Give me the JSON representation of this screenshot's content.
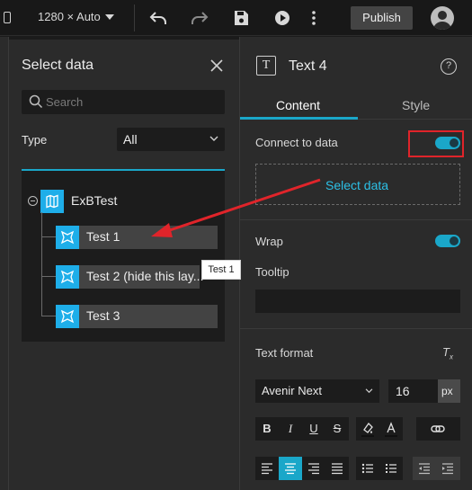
{
  "topbar": {
    "resolution_label": "1280 × Auto",
    "publish_label": "Publish"
  },
  "select_data": {
    "title": "Select data",
    "search_placeholder": "Search",
    "type_label": "Type",
    "type_value": "All",
    "tree": {
      "root": "ExBTest",
      "items": [
        {
          "label": "Test 1"
        },
        {
          "label": "Test 2 (hide this lay..."
        },
        {
          "label": "Test 3"
        }
      ]
    },
    "hover_tooltip": "Test 1"
  },
  "settings": {
    "title": "Text 4",
    "tabs": [
      {
        "label": "Content"
      },
      {
        "label": "Style"
      }
    ],
    "connect_to_data_label": "Connect to data",
    "connect_to_data_on": true,
    "select_data_button": "Select data",
    "wrap_label": "Wrap",
    "wrap_on": true,
    "tooltip_label": "Tooltip",
    "text_format_label": "Text format",
    "font_family": "Avenir Next",
    "font_size": "16",
    "font_unit": "px",
    "style_buttons": [
      "B",
      "I",
      "U",
      "S"
    ],
    "active_alignment": "center"
  },
  "colors": {
    "accent": "#1aa7c9",
    "highlight_red": "#e0242a",
    "layer_icon": "#1eaee9"
  }
}
